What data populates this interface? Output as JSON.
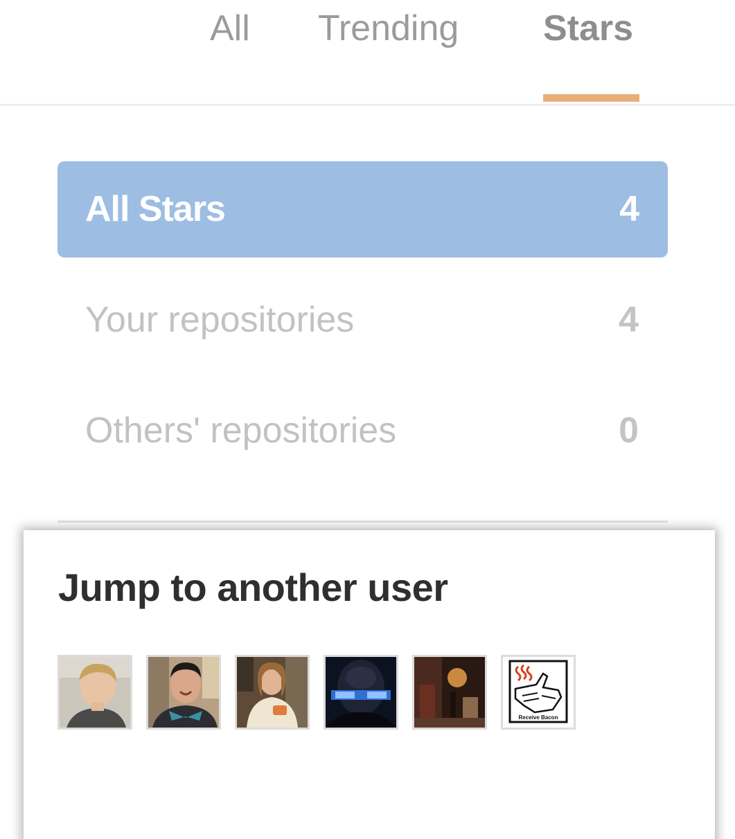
{
  "tabs": [
    {
      "label": "All",
      "active": false
    },
    {
      "label": "Trending",
      "active": false
    },
    {
      "label": "Stars",
      "active": true
    }
  ],
  "accent_color": "#e9ae78",
  "active_row_color": "#9dbde2",
  "filters": [
    {
      "label": "All Stars",
      "count": "4",
      "active": true
    },
    {
      "label": "Your repositories",
      "count": "4",
      "active": false
    },
    {
      "label": "Others' repositories",
      "count": "0",
      "active": false
    }
  ],
  "popup": {
    "title": "Jump to another user",
    "avatars": [
      {
        "icon": "user-avatar-1"
      },
      {
        "icon": "user-avatar-2"
      },
      {
        "icon": "user-avatar-3"
      },
      {
        "icon": "user-avatar-4"
      },
      {
        "icon": "user-avatar-5"
      },
      {
        "icon": "receive-bacon-icon",
        "caption": "Receive Bacon"
      }
    ]
  }
}
